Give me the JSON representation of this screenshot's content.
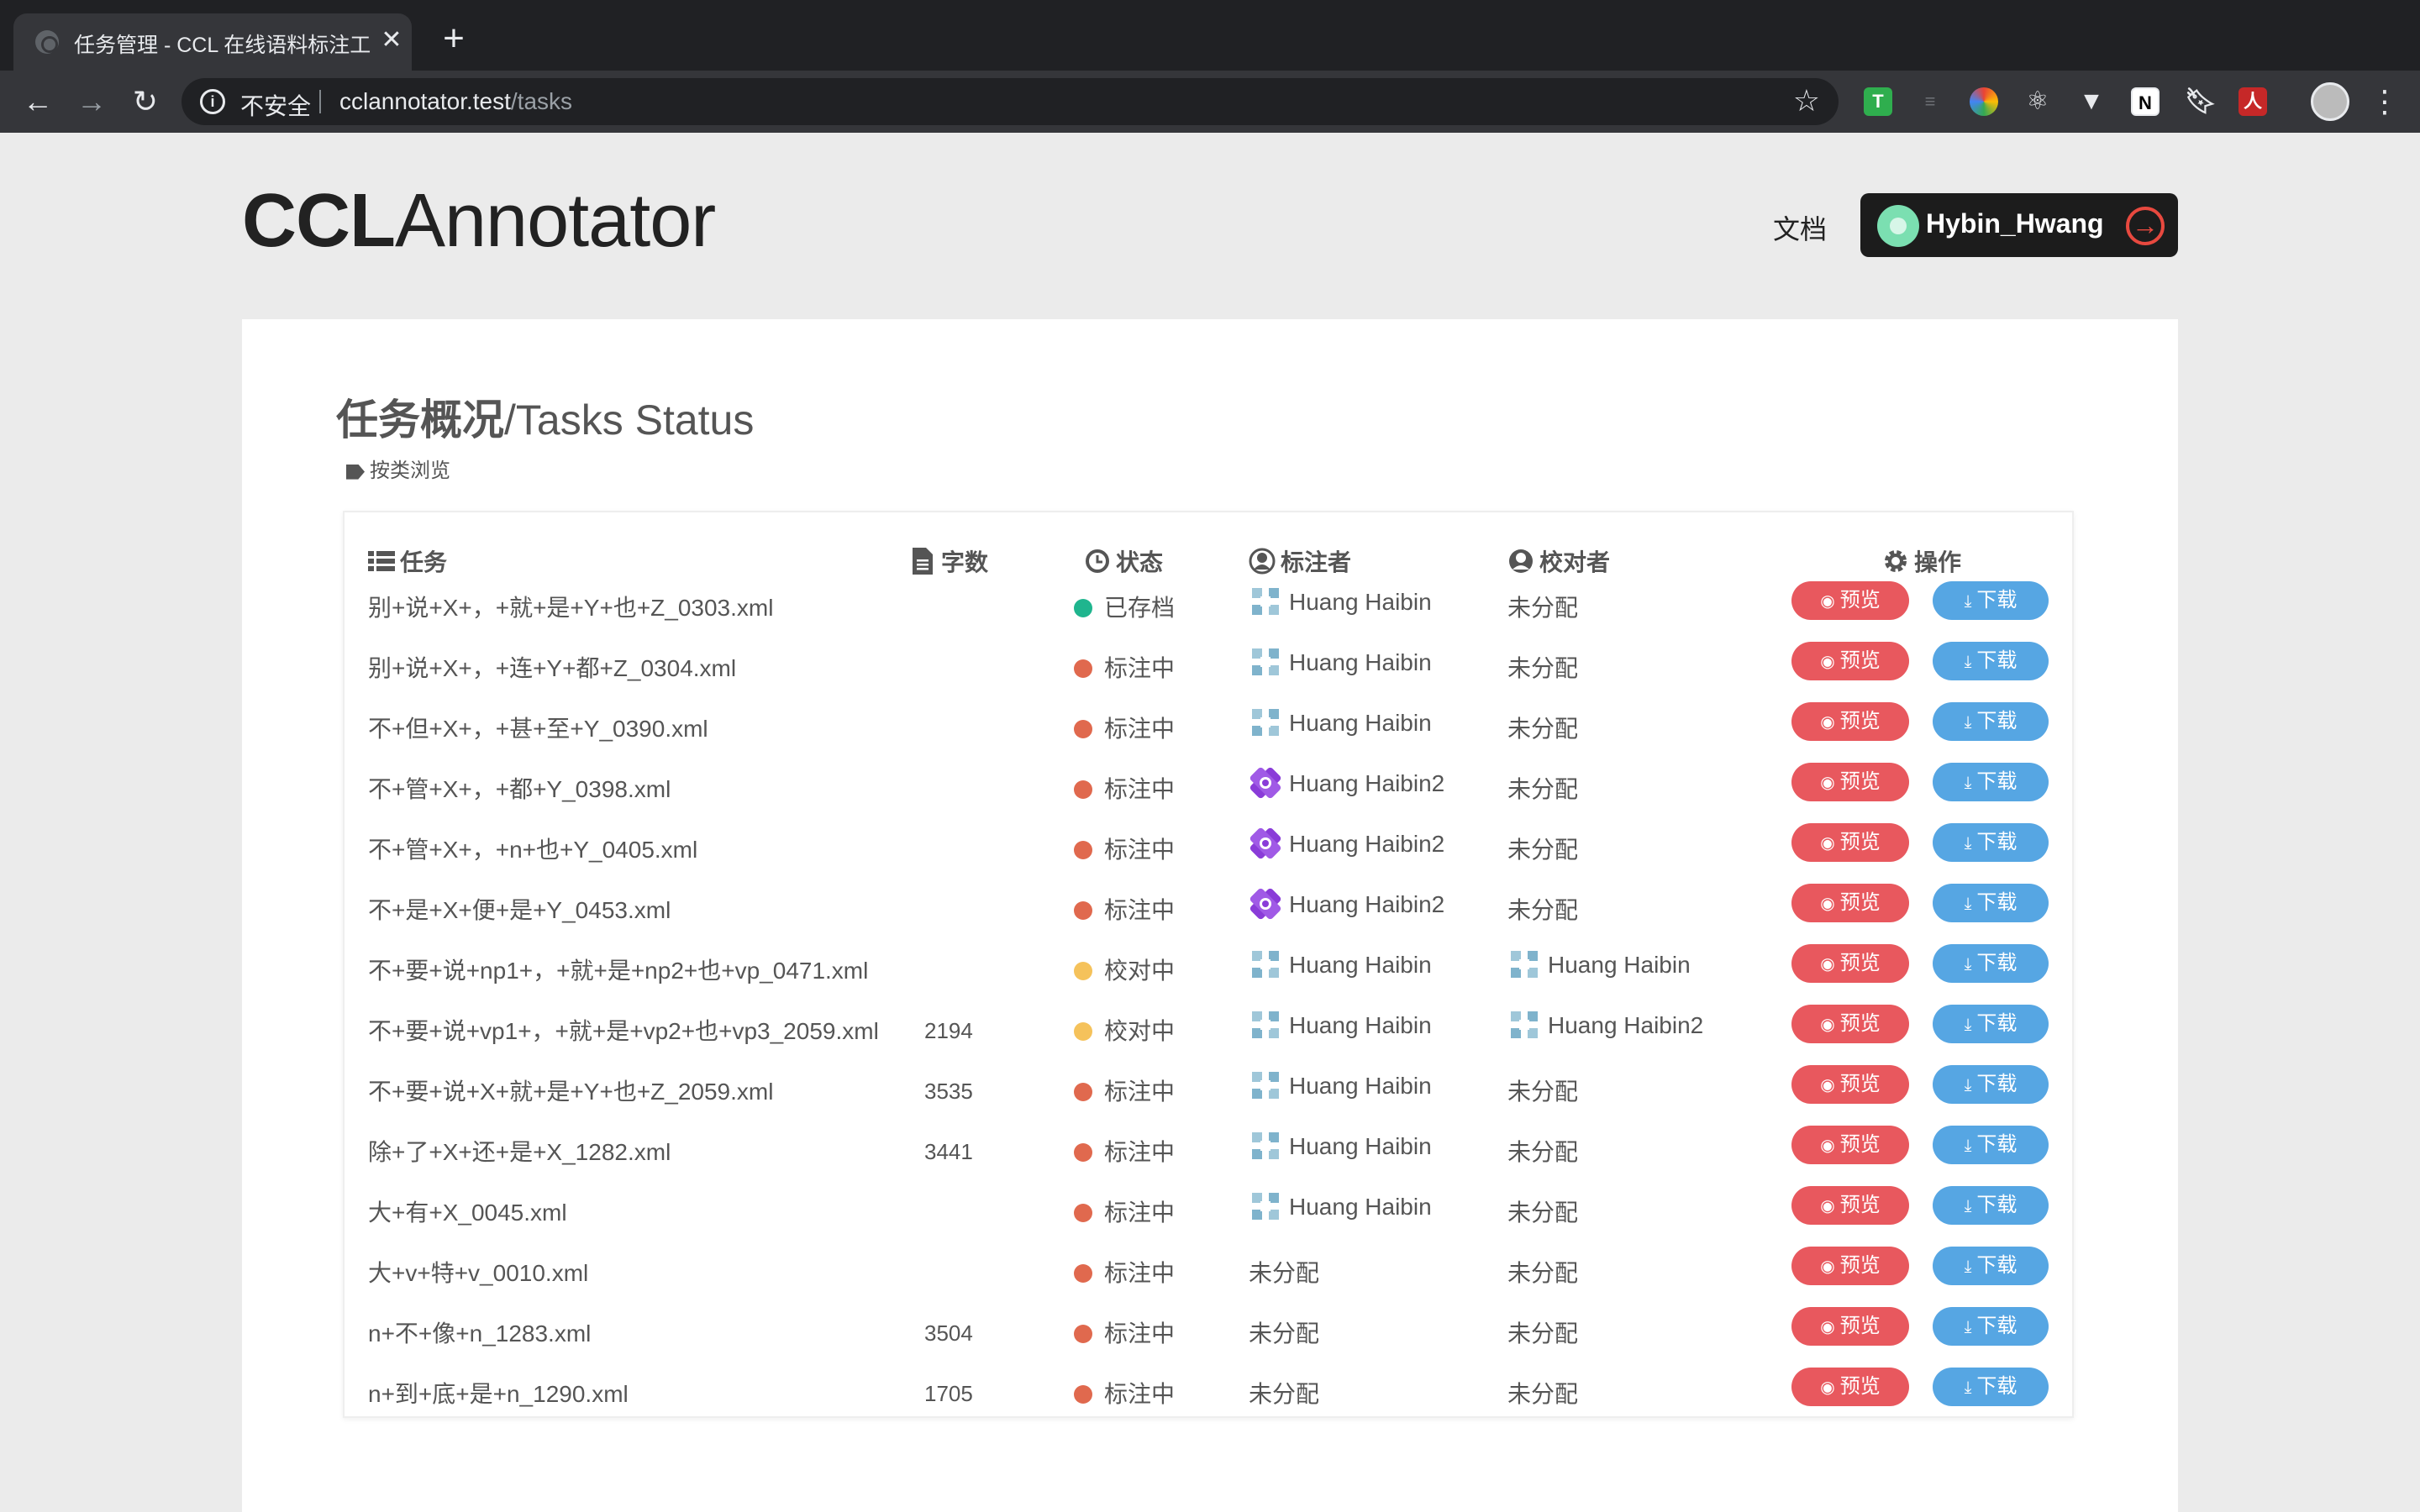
{
  "browser": {
    "tab_title": "任务管理 - CCL 在线语料标注工",
    "tab_close": "✕",
    "new_tab": "+",
    "insecure_label": "不安全",
    "url_host": "cclannotator.test",
    "url_path": "/tasks"
  },
  "header": {
    "logo_bold": "CCL",
    "logo_light": "Annotator",
    "docs_link": "文档",
    "username": "Hybin_Hwang"
  },
  "page": {
    "title_cn": "任务概况",
    "title_en": "/Tasks Status",
    "browse_by_category": "按类浏览"
  },
  "table": {
    "headers": {
      "task": "任务",
      "word_count": "字数",
      "status": "状态",
      "annotator": "标注者",
      "reviewer": "校对者",
      "actions": "操作"
    },
    "preview_label": "预览",
    "download_label": "下载",
    "rows": [
      {
        "name": "别+说+X+，+就+是+Y+也+Z_0303.xml",
        "count": "",
        "status": "已存档",
        "annotator": "Huang Haibin",
        "reviewer": "未分配"
      },
      {
        "name": "别+说+X+，+连+Y+都+Z_0304.xml",
        "count": "",
        "status": "标注中",
        "annotator": "Huang Haibin",
        "reviewer": "未分配"
      },
      {
        "name": "不+但+X+，+甚+至+Y_0390.xml",
        "count": "",
        "status": "标注中",
        "annotator": "Huang Haibin",
        "reviewer": "未分配"
      },
      {
        "name": "不+管+X+，+都+Y_0398.xml",
        "count": "",
        "status": "标注中",
        "annotator": "Huang Haibin2",
        "reviewer": "未分配"
      },
      {
        "name": "不+管+X+，+n+也+Y_0405.xml",
        "count": "",
        "status": "标注中",
        "annotator": "Huang Haibin2",
        "reviewer": "未分配"
      },
      {
        "name": "不+是+X+便+是+Y_0453.xml",
        "count": "",
        "status": "标注中",
        "annotator": "Huang Haibin2",
        "reviewer": "未分配"
      },
      {
        "name": "不+要+说+np1+，+就+是+np2+也+vp_0471.xml",
        "count": "",
        "status": "校对中",
        "annotator": "Huang Haibin",
        "reviewer": "Huang Haibin"
      },
      {
        "name": "不+要+说+vp1+，+就+是+vp2+也+vp3_2059.xml",
        "count": "2194",
        "status": "校对中",
        "annotator": "Huang Haibin",
        "reviewer": "Huang Haibin2"
      },
      {
        "name": "不+要+说+X+就+是+Y+也+Z_2059.xml",
        "count": "3535",
        "status": "标注中",
        "annotator": "Huang Haibin",
        "reviewer": "未分配"
      },
      {
        "name": "除+了+X+还+是+X_1282.xml",
        "count": "3441",
        "status": "标注中",
        "annotator": "Huang Haibin",
        "reviewer": "未分配"
      },
      {
        "name": "大+有+X_0045.xml",
        "count": "",
        "status": "标注中",
        "annotator": "Huang Haibin",
        "reviewer": "未分配"
      },
      {
        "name": "大+v+特+v_0010.xml",
        "count": "",
        "status": "标注中",
        "annotator": "未分配",
        "reviewer": "未分配"
      },
      {
        "name": "n+不+像+n_1283.xml",
        "count": "3504",
        "status": "标注中",
        "annotator": "未分配",
        "reviewer": "未分配"
      },
      {
        "name": "n+到+底+是+n_1290.xml",
        "count": "1705",
        "status": "标注中",
        "annotator": "未分配",
        "reviewer": "未分配"
      }
    ]
  },
  "colors": {
    "status_archived": "#1fb58e",
    "status_annotating": "#e0694e",
    "status_reviewing": "#f5c25b",
    "preview_button": "#e8585e",
    "download_button": "#56a6e3"
  }
}
